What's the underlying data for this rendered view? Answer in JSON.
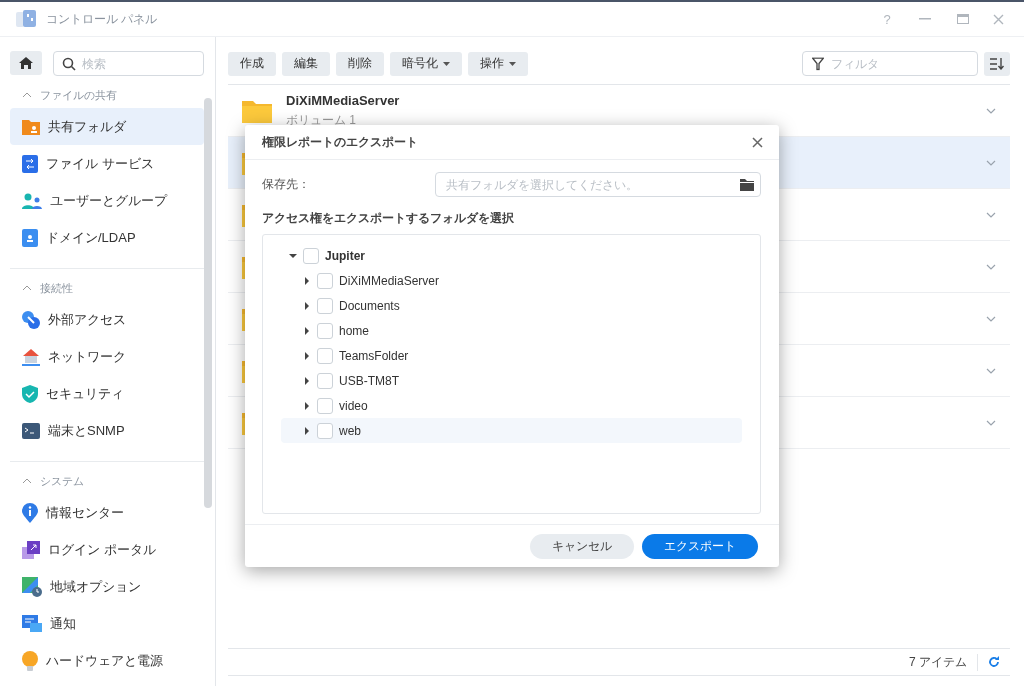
{
  "window": {
    "title": "コントロール パネル",
    "help": "?"
  },
  "sidebar": {
    "search": {
      "placeholder": "検索"
    },
    "sections": [
      {
        "title": "ファイルの共有",
        "expanded": true,
        "items": [
          {
            "label": "共有フォルダ",
            "selected": true
          },
          {
            "label": "ファイル サービス",
            "selected": false
          },
          {
            "label": "ユーザーとグループ",
            "selected": false
          },
          {
            "label": "ドメイン/LDAP",
            "selected": false
          }
        ]
      },
      {
        "title": "接続性",
        "expanded": true,
        "items": [
          {
            "label": "外部アクセス",
            "selected": false
          },
          {
            "label": "ネットワーク",
            "selected": false
          },
          {
            "label": "セキュリティ",
            "selected": false
          },
          {
            "label": "端末とSNMP",
            "selected": false
          }
        ]
      },
      {
        "title": "システム",
        "expanded": true,
        "items": [
          {
            "label": "情報センター",
            "selected": false
          },
          {
            "label": "ログイン ポータル",
            "selected": false
          },
          {
            "label": "地域オプション",
            "selected": false
          },
          {
            "label": "通知",
            "selected": false
          },
          {
            "label": "ハードウェアと電源",
            "selected": false
          }
        ]
      }
    ]
  },
  "toolbar": {
    "buttons": [
      {
        "label": "作成",
        "kind": "plain"
      },
      {
        "label": "編集",
        "kind": "plain"
      },
      {
        "label": "削除",
        "kind": "plain"
      },
      {
        "label": "暗号化",
        "kind": "dropdown"
      },
      {
        "label": "操作",
        "kind": "dropdown"
      }
    ],
    "filter": {
      "placeholder": "フィルタ"
    }
  },
  "folders": [
    {
      "name": "DiXiMMediaServer",
      "subtitle": "ボリューム 1",
      "selected": false
    },
    {
      "selected": true
    },
    {
      "selected": false
    },
    {
      "selected": false
    },
    {
      "selected": false
    },
    {
      "selected": false
    },
    {
      "selected": false
    }
  ],
  "status_bar": {
    "count": "7 アイテム"
  },
  "dialog": {
    "title": "権限レポートのエクスポート",
    "destination": {
      "label": "保存先：",
      "placeholder": "共有フォルダを選択してください。"
    },
    "section_label": "アクセス権をエクスポートするフォルダを選択",
    "tree": [
      {
        "label": "Jupiter",
        "checked": false,
        "expanded": true,
        "highlighted": false,
        "children": [
          {
            "label": "DiXiMMediaServer",
            "checked": false,
            "expanded": false,
            "highlighted": false
          },
          {
            "label": "Documents",
            "checked": false,
            "expanded": false,
            "highlighted": false
          },
          {
            "label": "home",
            "checked": false,
            "expanded": false,
            "highlighted": false
          },
          {
            "label": "TeamsFolder",
            "checked": false,
            "expanded": false,
            "highlighted": false
          },
          {
            "label": "USB-TM8T",
            "checked": false,
            "expanded": false,
            "highlighted": false
          },
          {
            "label": "video",
            "checked": false,
            "expanded": false,
            "highlighted": false
          },
          {
            "label": "web",
            "checked": false,
            "expanded": false,
            "highlighted": true
          }
        ]
      }
    ],
    "buttons": [
      {
        "label": "キャンセル",
        "kind": "secondary"
      },
      {
        "label": "エクスポート",
        "kind": "primary"
      }
    ]
  }
}
